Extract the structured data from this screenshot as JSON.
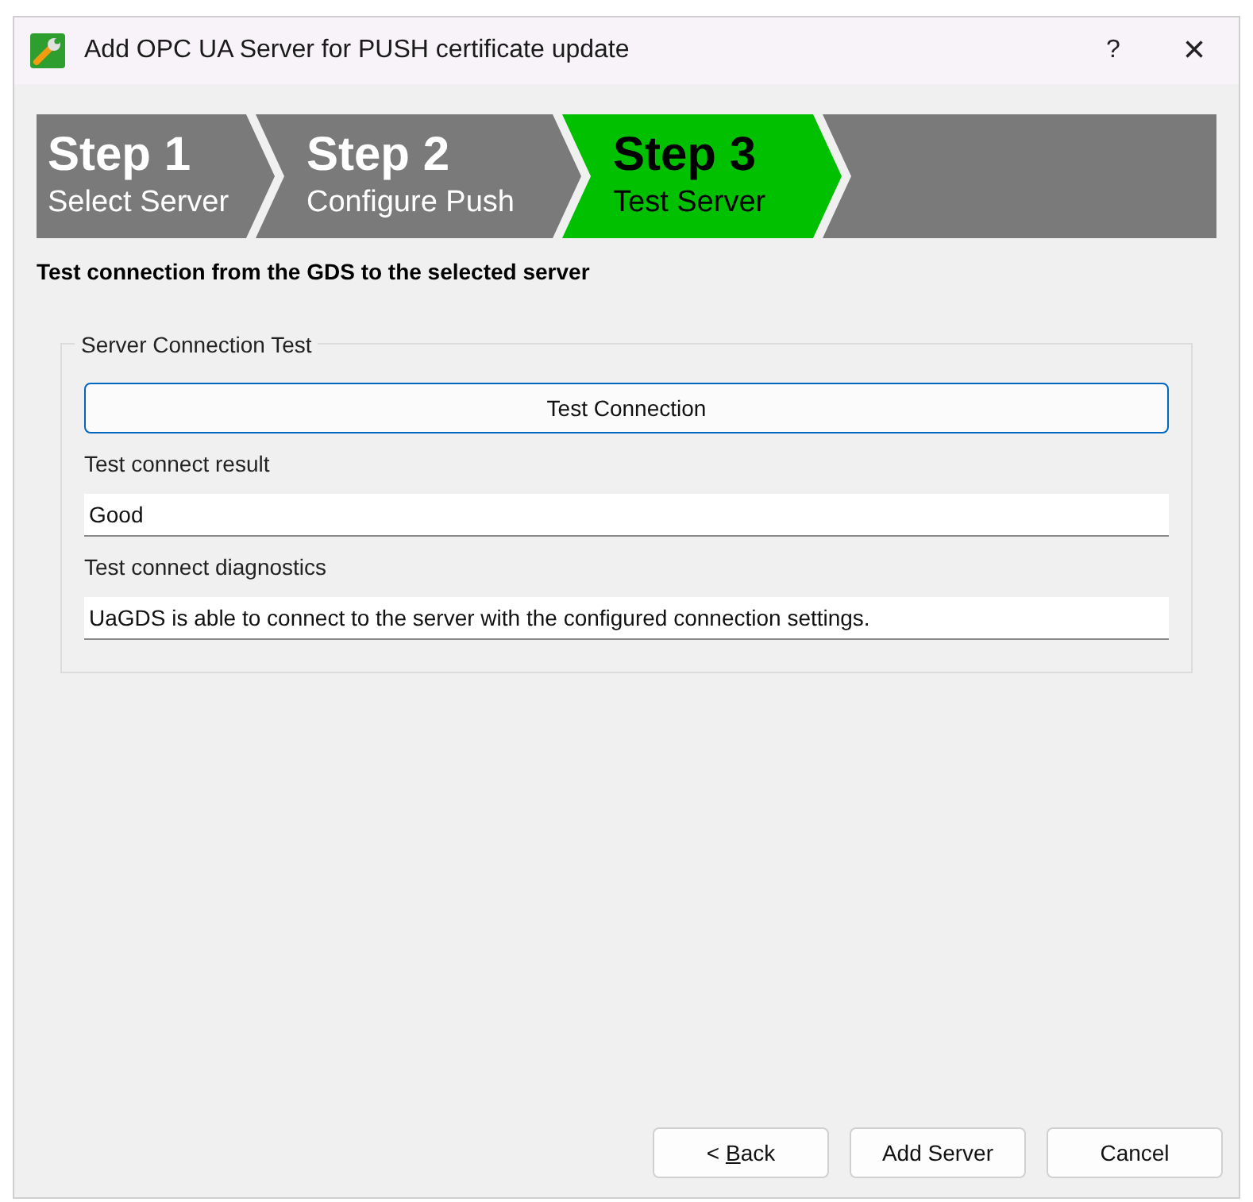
{
  "window": {
    "title": "Add OPC UA Server for PUSH certificate update",
    "help": "?",
    "close": "×"
  },
  "steps": [
    {
      "title": "Step 1",
      "subtitle": "Select Server",
      "selected": false
    },
    {
      "title": "Step 2",
      "subtitle": "Configure Push",
      "selected": false
    },
    {
      "title": "Step 3",
      "subtitle": "Test Server",
      "selected": true
    }
  ],
  "heading": "Test connection from the GDS to the selected server",
  "group": {
    "title": "Server Connection Test",
    "test_button": "Test Connection",
    "fields": [
      {
        "label": "Test connect result",
        "value": "Good"
      },
      {
        "label": "Test connect diagnostics",
        "value": "UaGDS is able to connect to the server with the configured connection settings."
      }
    ]
  },
  "buttons": [
    {
      "label": "< ",
      "mnemonic": "B",
      "label_rest": "ack"
    },
    {
      "label": "Add Server"
    },
    {
      "label": "Cancel"
    }
  ]
}
